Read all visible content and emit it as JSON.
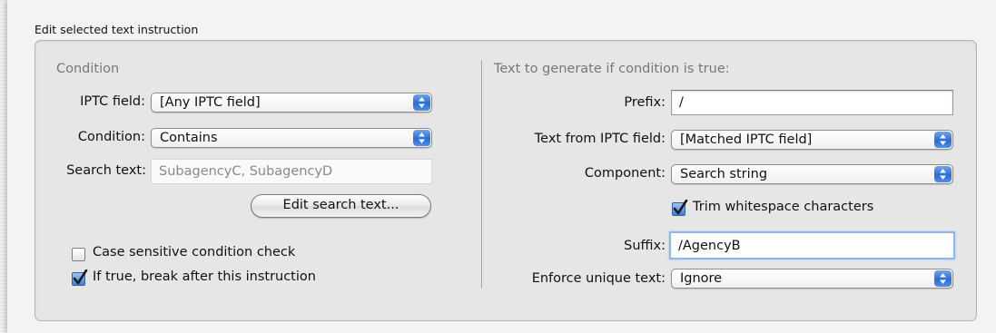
{
  "group": {
    "title": "Edit selected text instruction"
  },
  "left": {
    "heading": "Condition",
    "iptc_label": "IPTC field:",
    "iptc_value": "[Any IPTC field]",
    "condition_label": "Condition:",
    "condition_value": "Contains",
    "search_label": "Search text:",
    "search_value": "SubagencyC, SubagencyD",
    "edit_button": "Edit search text...",
    "case_sensitive": {
      "label": "Case sensitive condition check",
      "checked": false
    },
    "break_after": {
      "label": "If true, break after this instruction",
      "checked": true
    }
  },
  "right": {
    "heading": "Text to generate if condition is true:",
    "prefix_label": "Prefix:",
    "prefix_value": "/",
    "text_from_label": "Text from IPTC field:",
    "text_from_value": "[Matched IPTC field]",
    "component_label": "Component:",
    "component_value": "Search string",
    "trim": {
      "label": "Trim whitespace characters",
      "checked": true
    },
    "suffix_label": "Suffix:",
    "suffix_value": "/AgencyB",
    "enforce_label": "Enforce unique text:",
    "enforce_value": "Ignore"
  },
  "colors": {
    "accent": "#3b7ee0",
    "heading_gray": "#777777",
    "focus_ring": "#8db6ee"
  },
  "icons": {
    "popup_arrows": "updown-arrows-icon",
    "checkmark": "checkmark-icon"
  }
}
